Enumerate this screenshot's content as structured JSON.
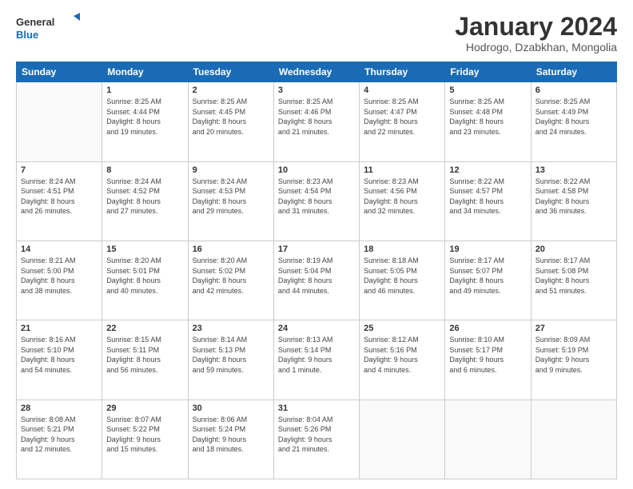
{
  "logo": {
    "line1": "General",
    "line2": "Blue"
  },
  "title": "January 2024",
  "subtitle": "Hodrogo, Dzabkhan, Mongolia",
  "weekdays": [
    "Sunday",
    "Monday",
    "Tuesday",
    "Wednesday",
    "Thursday",
    "Friday",
    "Saturday"
  ],
  "weeks": [
    [
      {
        "day": "",
        "info": ""
      },
      {
        "day": "1",
        "info": "Sunrise: 8:25 AM\nSunset: 4:44 PM\nDaylight: 8 hours\nand 19 minutes."
      },
      {
        "day": "2",
        "info": "Sunrise: 8:25 AM\nSunset: 4:45 PM\nDaylight: 8 hours\nand 20 minutes."
      },
      {
        "day": "3",
        "info": "Sunrise: 8:25 AM\nSunset: 4:46 PM\nDaylight: 8 hours\nand 21 minutes."
      },
      {
        "day": "4",
        "info": "Sunrise: 8:25 AM\nSunset: 4:47 PM\nDaylight: 8 hours\nand 22 minutes."
      },
      {
        "day": "5",
        "info": "Sunrise: 8:25 AM\nSunset: 4:48 PM\nDaylight: 8 hours\nand 23 minutes."
      },
      {
        "day": "6",
        "info": "Sunrise: 8:25 AM\nSunset: 4:49 PM\nDaylight: 8 hours\nand 24 minutes."
      }
    ],
    [
      {
        "day": "7",
        "info": "Sunrise: 8:24 AM\nSunset: 4:51 PM\nDaylight: 8 hours\nand 26 minutes."
      },
      {
        "day": "8",
        "info": "Sunrise: 8:24 AM\nSunset: 4:52 PM\nDaylight: 8 hours\nand 27 minutes."
      },
      {
        "day": "9",
        "info": "Sunrise: 8:24 AM\nSunset: 4:53 PM\nDaylight: 8 hours\nand 29 minutes."
      },
      {
        "day": "10",
        "info": "Sunrise: 8:23 AM\nSunset: 4:54 PM\nDaylight: 8 hours\nand 31 minutes."
      },
      {
        "day": "11",
        "info": "Sunrise: 8:23 AM\nSunset: 4:56 PM\nDaylight: 8 hours\nand 32 minutes."
      },
      {
        "day": "12",
        "info": "Sunrise: 8:22 AM\nSunset: 4:57 PM\nDaylight: 8 hours\nand 34 minutes."
      },
      {
        "day": "13",
        "info": "Sunrise: 8:22 AM\nSunset: 4:58 PM\nDaylight: 8 hours\nand 36 minutes."
      }
    ],
    [
      {
        "day": "14",
        "info": "Sunrise: 8:21 AM\nSunset: 5:00 PM\nDaylight: 8 hours\nand 38 minutes."
      },
      {
        "day": "15",
        "info": "Sunrise: 8:20 AM\nSunset: 5:01 PM\nDaylight: 8 hours\nand 40 minutes."
      },
      {
        "day": "16",
        "info": "Sunrise: 8:20 AM\nSunset: 5:02 PM\nDaylight: 8 hours\nand 42 minutes."
      },
      {
        "day": "17",
        "info": "Sunrise: 8:19 AM\nSunset: 5:04 PM\nDaylight: 8 hours\nand 44 minutes."
      },
      {
        "day": "18",
        "info": "Sunrise: 8:18 AM\nSunset: 5:05 PM\nDaylight: 8 hours\nand 46 minutes."
      },
      {
        "day": "19",
        "info": "Sunrise: 8:17 AM\nSunset: 5:07 PM\nDaylight: 8 hours\nand 49 minutes."
      },
      {
        "day": "20",
        "info": "Sunrise: 8:17 AM\nSunset: 5:08 PM\nDaylight: 8 hours\nand 51 minutes."
      }
    ],
    [
      {
        "day": "21",
        "info": "Sunrise: 8:16 AM\nSunset: 5:10 PM\nDaylight: 8 hours\nand 54 minutes."
      },
      {
        "day": "22",
        "info": "Sunrise: 8:15 AM\nSunset: 5:11 PM\nDaylight: 8 hours\nand 56 minutes."
      },
      {
        "day": "23",
        "info": "Sunrise: 8:14 AM\nSunset: 5:13 PM\nDaylight: 8 hours\nand 59 minutes."
      },
      {
        "day": "24",
        "info": "Sunrise: 8:13 AM\nSunset: 5:14 PM\nDaylight: 9 hours\nand 1 minute."
      },
      {
        "day": "25",
        "info": "Sunrise: 8:12 AM\nSunset: 5:16 PM\nDaylight: 9 hours\nand 4 minutes."
      },
      {
        "day": "26",
        "info": "Sunrise: 8:10 AM\nSunset: 5:17 PM\nDaylight: 9 hours\nand 6 minutes."
      },
      {
        "day": "27",
        "info": "Sunrise: 8:09 AM\nSunset: 5:19 PM\nDaylight: 9 hours\nand 9 minutes."
      }
    ],
    [
      {
        "day": "28",
        "info": "Sunrise: 8:08 AM\nSunset: 5:21 PM\nDaylight: 9 hours\nand 12 minutes."
      },
      {
        "day": "29",
        "info": "Sunrise: 8:07 AM\nSunset: 5:22 PM\nDaylight: 9 hours\nand 15 minutes."
      },
      {
        "day": "30",
        "info": "Sunrise: 8:06 AM\nSunset: 5:24 PM\nDaylight: 9 hours\nand 18 minutes."
      },
      {
        "day": "31",
        "info": "Sunrise: 8:04 AM\nSunset: 5:26 PM\nDaylight: 9 hours\nand 21 minutes."
      },
      {
        "day": "",
        "info": ""
      },
      {
        "day": "",
        "info": ""
      },
      {
        "day": "",
        "info": ""
      }
    ]
  ]
}
